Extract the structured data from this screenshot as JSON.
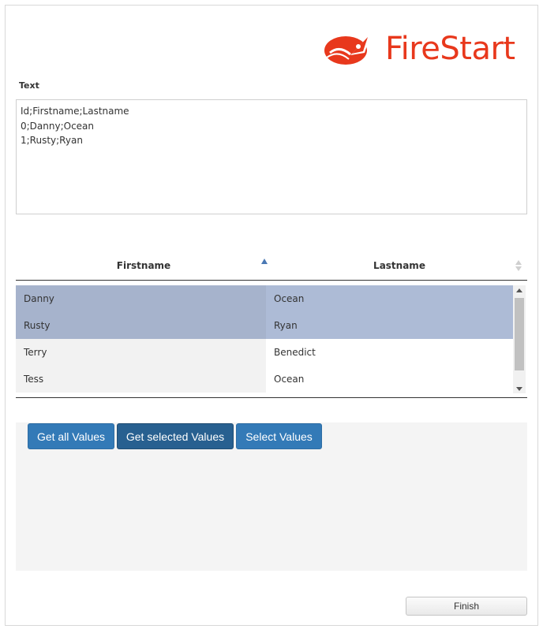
{
  "logo": {
    "text": "FireStart",
    "icon": "rocket-logo-icon",
    "color": "#e8381c"
  },
  "text_field": {
    "label": "Text",
    "value": "Id;Firstname;Lastname\n0;Danny;Ocean\n1;Rusty;Ryan"
  },
  "grid": {
    "columns": [
      {
        "label": "Firstname",
        "sort": "ascending"
      },
      {
        "label": "Lastname",
        "sort": "none"
      }
    ],
    "rows": [
      {
        "firstname": "Danny",
        "lastname": "Ocean",
        "selected": true
      },
      {
        "firstname": "Rusty",
        "lastname": "Ryan",
        "selected": true
      },
      {
        "firstname": "Terry",
        "lastname": "Benedict",
        "selected": false
      },
      {
        "firstname": "Tess",
        "lastname": "Ocean",
        "selected": false
      }
    ],
    "selection_color": "#adbbd6"
  },
  "buttons": {
    "get_all": "Get all Values",
    "get_selected": "Get selected Values",
    "select": "Select Values",
    "color": "#337ab7"
  },
  "footer": {
    "finish": "Finish"
  }
}
